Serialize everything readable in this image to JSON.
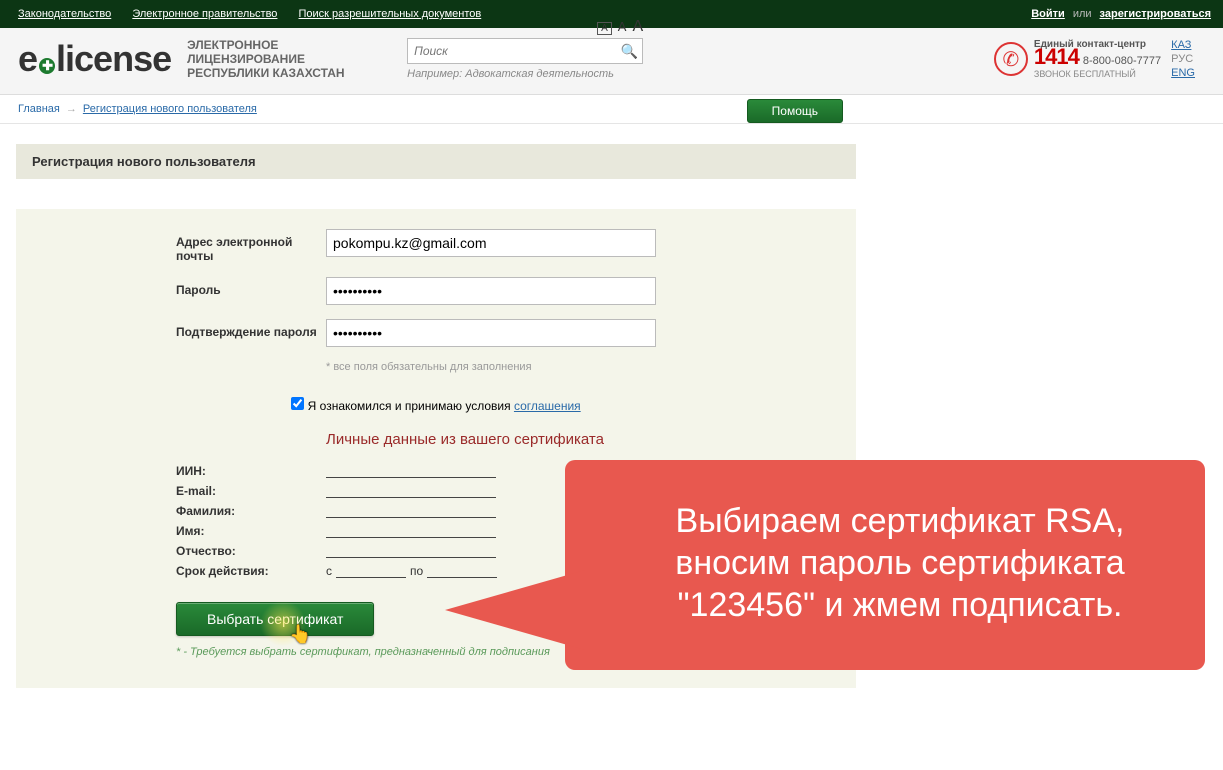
{
  "topnav": {
    "links": [
      "Законодательство",
      "Электронное правительство",
      "Поиск разрешительных документов"
    ],
    "login": "Войти",
    "or": "или",
    "register": "зарегистрироваться"
  },
  "header": {
    "logo_e": "e",
    "logo_rest": "license",
    "subtitle_l1": "ЭЛЕКТРОННОЕ ЛИЦЕНЗИРОВАНИЕ",
    "subtitle_l2": "РЕСПУБЛИКИ КАЗАХСТАН",
    "search_placeholder": "Поиск",
    "search_hint": "Например: Адвокатская деятельность",
    "contact_title": "Единый контакт-центр",
    "contact_big": "1414",
    "contact_phone": "8-800-080-7777",
    "contact_free": "ЗВОНОК БЕСПЛАТНЫЙ",
    "langs": {
      "kaz": "КАЗ",
      "rus": "РУС",
      "eng": "ENG"
    }
  },
  "breadcrumb": {
    "home": "Главная",
    "current": "Регистрация нового пользователя",
    "help": "Помощь"
  },
  "section_title": "Регистрация нового пользователя",
  "form": {
    "email_label": "Адрес электронной почты",
    "email_value": "pokompu.kz@gmail.com",
    "password_label": "Пароль",
    "password_value": "••••••••••",
    "confirm_label": "Подтверждение пароля",
    "confirm_value": "••••••••••",
    "required_note": "* все поля обязательны для заполнения",
    "agree_text": "Я ознакомился и принимаю условия ",
    "agree_link": "соглашения"
  },
  "cert": {
    "title": "Личные данные из вашего сертификата",
    "iin": "ИИН:",
    "email": "E-mail:",
    "lastname": "Фамилия:",
    "name": "Имя:",
    "patr": "Отчество:",
    "term": "Срок действия:",
    "term_from": "с",
    "term_to": "по",
    "button": "Выбрать сертификат",
    "note": "* - Требуется выбрать сертификат, предназначенный для подписания"
  },
  "callout_text": "Выбираем сертификат RSA, вносим пароль сертификата \"123456\" и жмем подписать."
}
